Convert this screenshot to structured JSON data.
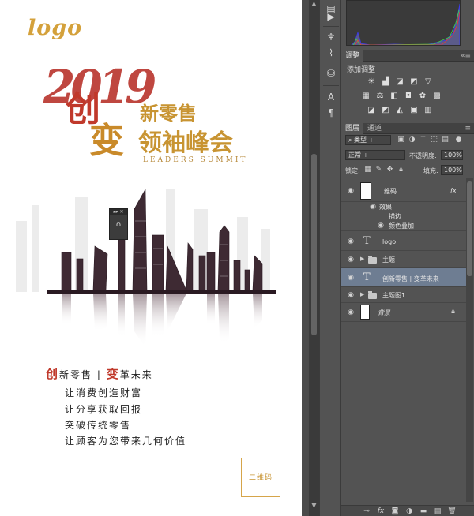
{
  "poster": {
    "logo_text": "logo",
    "title": {
      "year": "2019",
      "char1": "创",
      "char2": "变",
      "line1": "新零售",
      "line2": "领袖峰会",
      "subtitle": "LEADERS SUMMIT"
    },
    "copy": {
      "line1_char_a": "创",
      "line1_text_a": "新零售 | ",
      "line1_char_b": "变",
      "line1_text_b": "革未来",
      "lines": [
        "让消费创造财富",
        "让分享获取回报",
        "突破传统零售",
        "让顾客为您带来几何价值"
      ]
    },
    "qr_label": "二维码"
  },
  "adjustments": {
    "tab_label": "调整",
    "add_label": "添加调整",
    "row1_icons": [
      "brightness-icon",
      "levels-icon",
      "curves-icon",
      "exposure-icon",
      "vibrance-icon"
    ],
    "row2_icons": [
      "hue-saturation-icon",
      "color-balance-icon",
      "black-white-icon",
      "photo-filter-icon",
      "channel-mixer-icon",
      "color-lookup-icon"
    ],
    "row3_icons": [
      "invert-icon",
      "posterize-icon",
      "threshold-icon",
      "selective-color-icon",
      "gradient-map-icon"
    ]
  },
  "layers_panel": {
    "tabs": [
      "图层",
      "通道"
    ],
    "filter_kind": "类型",
    "blend_mode": "正常",
    "opacity_label": "不透明度:",
    "opacity_value": "100%",
    "lock_label": "锁定:",
    "fill_label": "填充:",
    "fill_value": "100%",
    "layers": [
      {
        "name": "二维码",
        "type": "smart",
        "fx": "fx"
      },
      {
        "name": "效果",
        "type": "effects"
      },
      {
        "name": "描边",
        "type": "effect"
      },
      {
        "name": "颜色叠加",
        "type": "effect"
      },
      {
        "name": "logo",
        "type": "text"
      },
      {
        "name": "主题",
        "type": "group"
      },
      {
        "name": "创新零售 | 变革未来",
        "type": "text",
        "selected": true
      },
      {
        "name": "主题图1",
        "type": "group"
      },
      {
        "name": "背景",
        "type": "background"
      }
    ]
  },
  "colors": {
    "gold": "#c89432",
    "red": "#c0392b",
    "selection": "#6e7d92",
    "panel_bg": "#535353"
  }
}
